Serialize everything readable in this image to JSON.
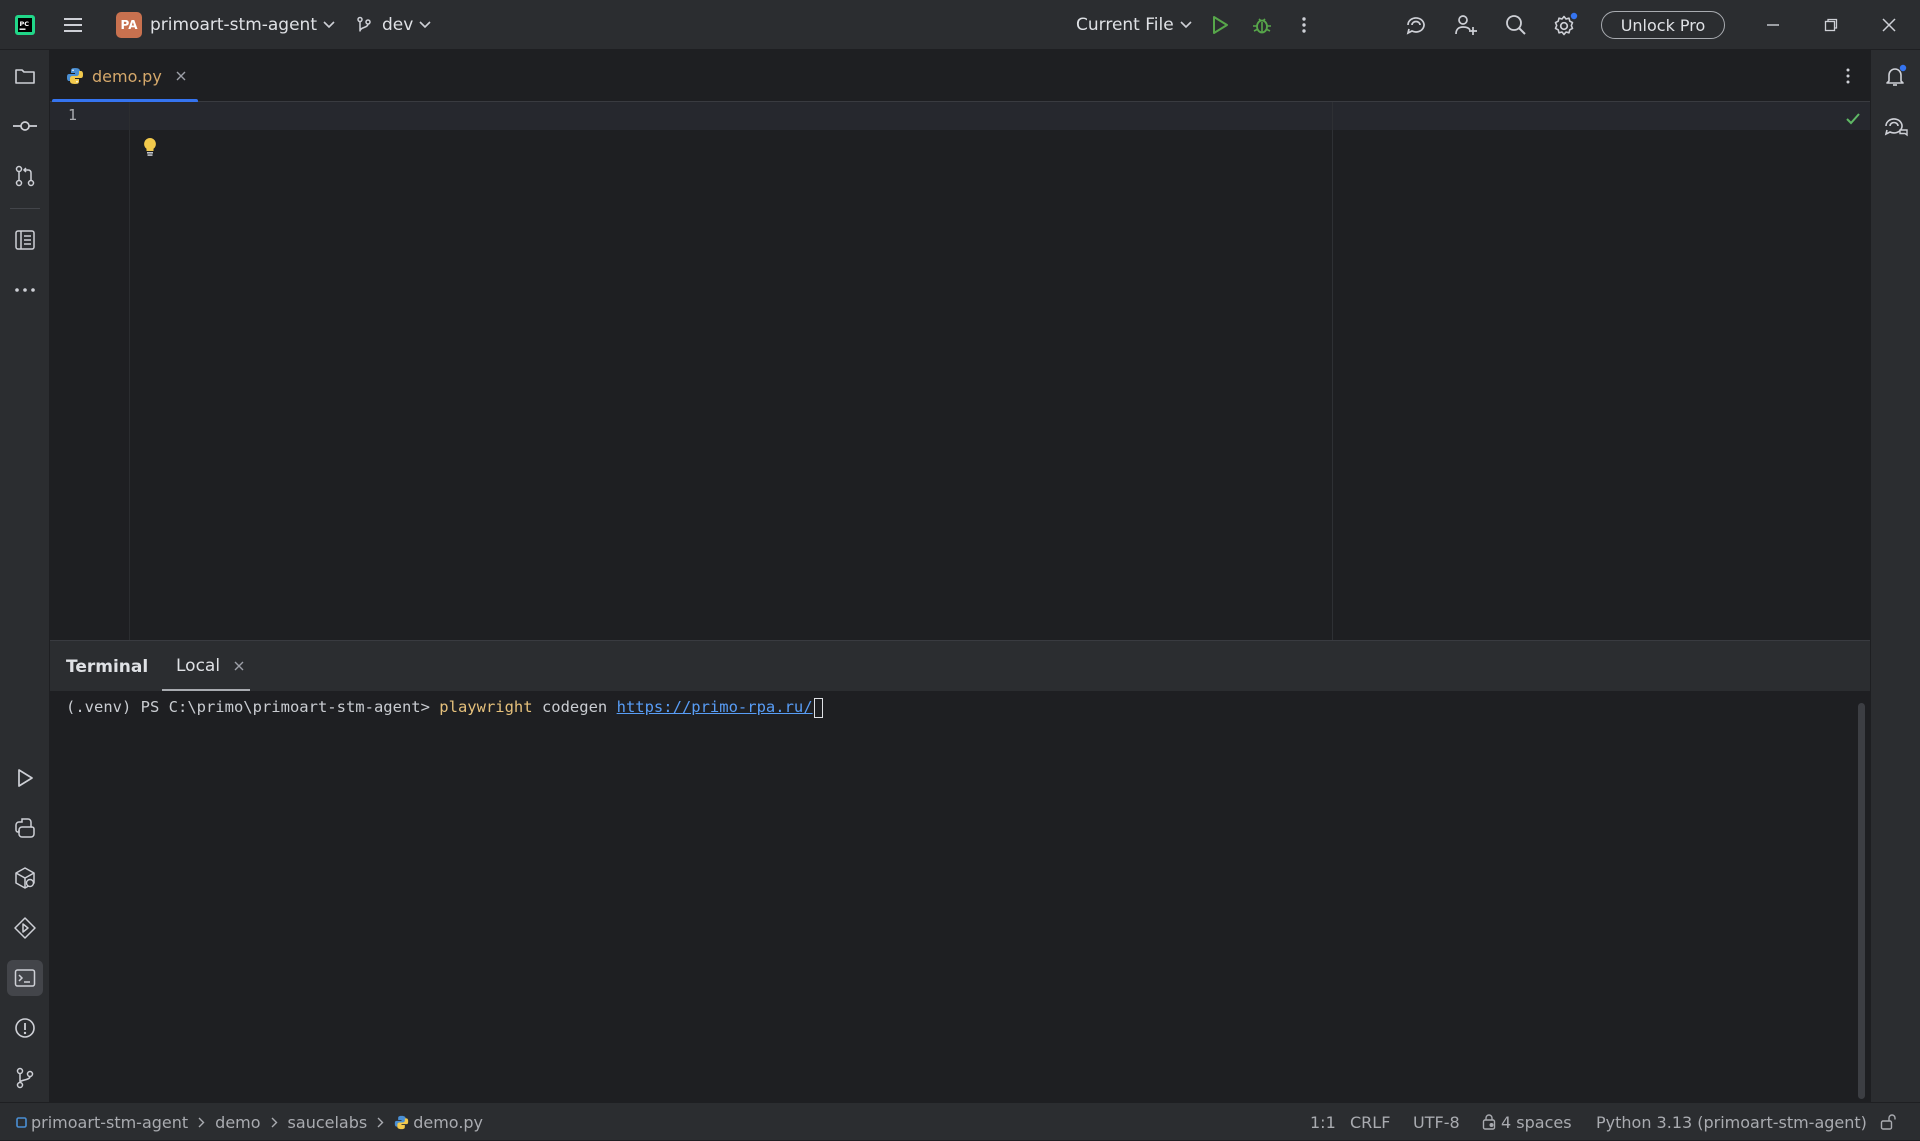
{
  "titlebar": {
    "project_initials": "PA",
    "project_name": "primoart-stm-agent",
    "branch": "dev",
    "run_config": "Current File",
    "unlock_pro": "Unlock Pro"
  },
  "editor": {
    "tab_label": "demo.py",
    "line_number": "1"
  },
  "terminal": {
    "title": "Terminal",
    "tab_label": "Local",
    "prompt": "(.venv) PS C:\\primo\\primoart-stm-agent> ",
    "command": "playwright",
    "argument": " codegen ",
    "url": "https://primo-rpa.ru/"
  },
  "statusbar": {
    "breadcrumbs": [
      "primoart-stm-agent",
      "demo",
      "saucelabs",
      "demo.py"
    ],
    "position": "1:1",
    "line_separator": "CRLF",
    "encoding": "UTF-8",
    "indent": "4 spaces",
    "interpreter": "Python 3.13 (primoart-stm-agent)"
  },
  "colors": {
    "accent": "#3574f0",
    "run_green": "#57a64a",
    "terminal_command": "#e5c07b",
    "terminal_link": "#589df6",
    "tab_file": "#d5a86b"
  },
  "icons": [
    "pycharm-logo-icon",
    "hamburger-menu-icon",
    "branch-icon",
    "run-icon",
    "debug-icon",
    "more-vertical-icon",
    "ai-assistant-icon",
    "add-user-icon",
    "search-icon",
    "settings-icon",
    "minimize-icon",
    "restore-icon",
    "close-icon",
    "folder-icon",
    "commit-icon",
    "pull-request-icon",
    "structure-icon",
    "more-horizontal-icon",
    "run-tool-icon",
    "python-console-icon",
    "python-packages-icon",
    "services-icon",
    "terminal-icon",
    "problems-icon",
    "git-icon",
    "notifications-icon",
    "ai-chat-icon",
    "python-file-icon",
    "lightbulb-icon",
    "check-icon",
    "lock-icon"
  ]
}
